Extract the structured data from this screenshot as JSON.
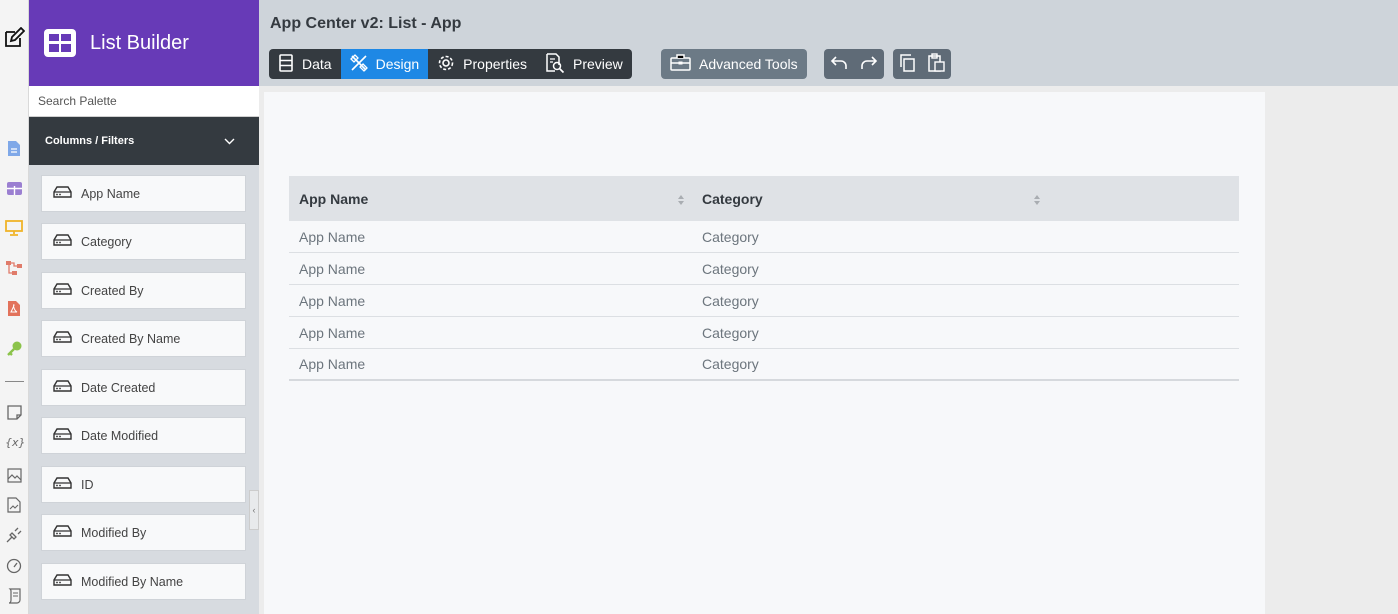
{
  "header": {
    "title": "App Center v2: List - App"
  },
  "palette": {
    "app_title": "List Builder",
    "search_placeholder": "Search Palette",
    "group_label": "Columns / Filters",
    "items": [
      {
        "label": "App Name"
      },
      {
        "label": "Category"
      },
      {
        "label": "Created By"
      },
      {
        "label": "Created By Name"
      },
      {
        "label": "Date Created"
      },
      {
        "label": "Date Modified"
      },
      {
        "label": "ID"
      },
      {
        "label": "Modified By"
      },
      {
        "label": "Modified By Name"
      }
    ]
  },
  "toolbar": {
    "data_label": "Data",
    "design_label": "Design",
    "properties_label": "Properties",
    "preview_label": "Preview",
    "advanced_label": "Advanced Tools",
    "active_tab": "Design"
  },
  "table": {
    "columns": [
      "App Name",
      "Category"
    ],
    "rows": [
      [
        "App Name",
        "Category"
      ],
      [
        "App Name",
        "Category"
      ],
      [
        "App Name",
        "Category"
      ],
      [
        "App Name",
        "Category"
      ],
      [
        "App Name",
        "Category"
      ]
    ]
  },
  "rail_icons": [
    "edit-icon",
    "document-icon",
    "list-icon",
    "monitor-icon",
    "workflow-icon",
    "pdf-icon",
    "key-icon",
    "note-icon",
    "variable-icon",
    "image-icon",
    "report-icon",
    "plug-icon",
    "gauge-icon",
    "script-icon"
  ],
  "colors": {
    "brand": "#673ab7",
    "active_tab": "#1e88e5",
    "toolbar_dark": "#343a40",
    "header_bg": "#ced4da"
  }
}
